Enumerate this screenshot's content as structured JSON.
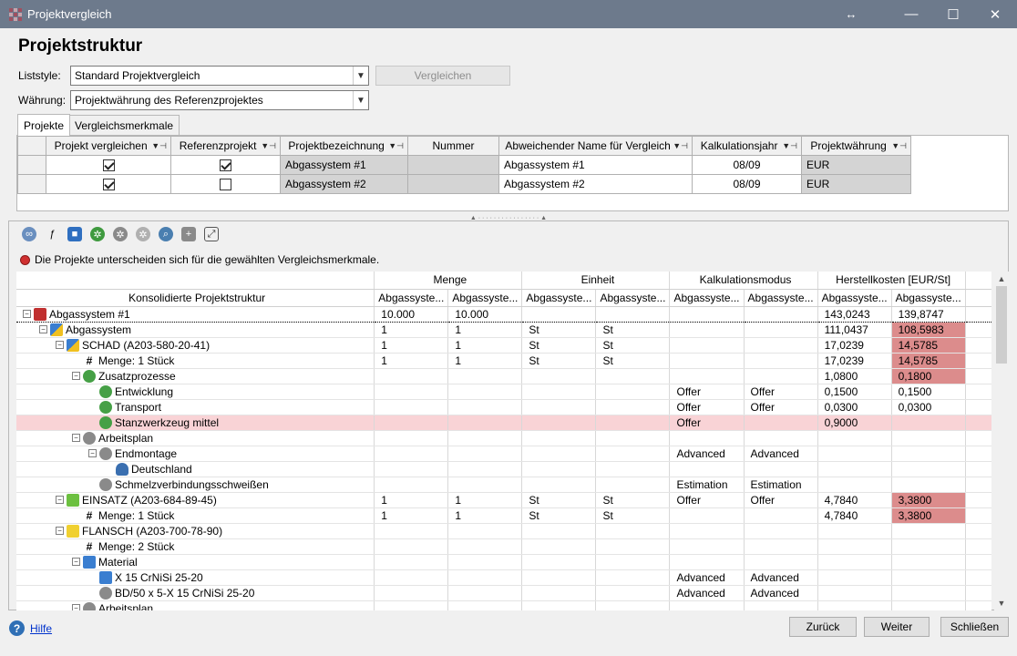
{
  "window": {
    "title": "Projektvergleich",
    "resize_glyph": "↔",
    "minimize": "—",
    "maximize": "☐",
    "close": "✕"
  },
  "page_title": "Projektstruktur",
  "liststyle": {
    "label": "Liststyle:",
    "value": "Standard Projektvergleich"
  },
  "compare_button": "Vergleichen",
  "currency": {
    "label": "Währung:",
    "value": "Projektwährung des Referenzprojektes"
  },
  "tabs": [
    {
      "label": "Projekte"
    },
    {
      "label": "Vergleichsmerkmale"
    }
  ],
  "projects_table": {
    "columns": [
      "Projekt vergleichen",
      "Referenzprojekt",
      "Projektbezeichnung",
      "Nummer",
      "Abweichender Name für Vergleich",
      "Kalkulationsjahr",
      "Projektwährung"
    ],
    "rows": [
      {
        "compare": true,
        "reference": true,
        "name": "Abgassystem #1",
        "number": "",
        "alt_name": "Abgassystem #1",
        "year": "08/09",
        "currency": "EUR"
      },
      {
        "compare": true,
        "reference": false,
        "name": "Abgassystem #2",
        "number": "",
        "alt_name": "Abgassystem #2",
        "year": "08/09",
        "currency": "EUR"
      }
    ]
  },
  "toolbar_icons": [
    "link-icon",
    "formula-icon",
    "cube-icon",
    "green-gear-icon",
    "gear-icon",
    "gear-outline-icon",
    "find-icon",
    "clipboard-add-icon",
    "expand-icon"
  ],
  "warning": "Die Projekte unterscheiden sich für die gewählten Vergleichsmerkmale.",
  "structure": {
    "tree_header": "Konsolidierte Projektstruktur",
    "groups": [
      "Menge",
      "Einheit",
      "Kalkulationsmodus",
      "Herstellkosten [EUR/St]"
    ],
    "sub_header": "Abgassyste...",
    "rows": [
      {
        "label": "Abgassystem #1",
        "indent": 0,
        "exp": "⊟",
        "icon": "project-icon",
        "c": [
          "10.000",
          "10.000",
          "",
          "",
          "",
          "",
          "143,0243",
          "139,8747"
        ],
        "hl": false
      },
      {
        "label": "Abgassystem",
        "indent": 1,
        "exp": "⊟",
        "icon": "assembly-icon",
        "c": [
          "1",
          "1",
          "St",
          "St",
          "",
          "",
          "111,0437",
          "108,5983"
        ],
        "hl": true
      },
      {
        "label": "SCHAD (A203-580-20-41)",
        "indent": 2,
        "exp": "⊟",
        "icon": "assembly-icon",
        "c": [
          "1",
          "1",
          "St",
          "St",
          "",
          "",
          "17,0239",
          "14,5785"
        ],
        "hl": true
      },
      {
        "label": "Menge: 1 Stück",
        "indent": 3,
        "exp": "",
        "icon": "hash",
        "c": [
          "1",
          "1",
          "St",
          "St",
          "",
          "",
          "17,0239",
          "14,5785"
        ],
        "hl": true
      },
      {
        "label": "Zusatzprozesse",
        "indent": 3,
        "exp": "⊟",
        "icon": "process-group-icon",
        "c": [
          "",
          "",
          "",
          "",
          "",
          "",
          "1,0800",
          "0,1800"
        ],
        "hl": true
      },
      {
        "label": "Entwicklung",
        "indent": 4,
        "exp": "",
        "icon": "process-icon",
        "c": [
          "",
          "",
          "",
          "",
          "Offer",
          "Offer",
          "0,1500",
          "0,1500"
        ],
        "hl": false
      },
      {
        "label": "Transport",
        "indent": 4,
        "exp": "",
        "icon": "process-icon",
        "c": [
          "",
          "",
          "",
          "",
          "Offer",
          "Offer",
          "0,0300",
          "0,0300"
        ],
        "hl": false
      },
      {
        "label": "Stanzwerkzeug mittel",
        "indent": 4,
        "exp": "",
        "icon": "process-icon",
        "c": [
          "",
          "",
          "",
          "",
          "Offer",
          "",
          "0,9000",
          ""
        ],
        "hl": false,
        "sel": true
      },
      {
        "label": "Arbeitsplan",
        "indent": 3,
        "exp": "⊟",
        "icon": "workplan-icon",
        "c": [
          "",
          "",
          "",
          "",
          "",
          "",
          "",
          ""
        ],
        "hl": false
      },
      {
        "label": "Endmontage",
        "indent": 4,
        "exp": "⊟",
        "icon": "operation-icon",
        "c": [
          "",
          "",
          "",
          "",
          "Advanced",
          "Advanced",
          "",
          ""
        ],
        "hl": false
      },
      {
        "label": "Deutschland",
        "indent": 5,
        "exp": "",
        "icon": "person-icon",
        "c": [
          "",
          "",
          "",
          "",
          "",
          "",
          "",
          ""
        ],
        "hl": false
      },
      {
        "label": "Schmelzverbindungsschweißen",
        "indent": 4,
        "exp": "",
        "icon": "operation-icon",
        "c": [
          "",
          "",
          "",
          "",
          "Estimation",
          "Estimation",
          "",
          ""
        ],
        "hl": false
      },
      {
        "label": "EINSATZ (A203-684-89-45)",
        "indent": 2,
        "exp": "⊟",
        "icon": "part-green-icon",
        "c": [
          "1",
          "1",
          "St",
          "St",
          "Offer",
          "Offer",
          "4,7840",
          "3,3800"
        ],
        "hl": true
      },
      {
        "label": "Menge: 1 Stück",
        "indent": 3,
        "exp": "",
        "icon": "hash",
        "c": [
          "1",
          "1",
          "St",
          "St",
          "",
          "",
          "4,7840",
          "3,3800"
        ],
        "hl": true
      },
      {
        "label": "FLANSCH (A203-700-78-90)",
        "indent": 2,
        "exp": "⊟",
        "icon": "part-yellow-icon",
        "c": [
          "",
          "",
          "",
          "",
          "",
          "",
          "",
          ""
        ],
        "hl": false
      },
      {
        "label": "Menge: 2 Stück",
        "indent": 3,
        "exp": "",
        "icon": "hash",
        "c": [
          "",
          "",
          "",
          "",
          "",
          "",
          "",
          ""
        ],
        "hl": false
      },
      {
        "label": "Material",
        "indent": 3,
        "exp": "⊟",
        "icon": "material-group-icon",
        "c": [
          "",
          "",
          "",
          "",
          "",
          "",
          "",
          ""
        ],
        "hl": false
      },
      {
        "label": "X 15 CrNiSi 25-20",
        "indent": 4,
        "exp": "",
        "icon": "material-icon",
        "c": [
          "",
          "",
          "",
          "",
          "Advanced",
          "Advanced",
          "",
          ""
        ],
        "hl": false
      },
      {
        "label": "BD/50 x 5-X 15 CrNiSi 25-20",
        "indent": 4,
        "exp": "",
        "icon": "material-bar-icon",
        "c": [
          "",
          "",
          "",
          "",
          "Advanced",
          "Advanced",
          "",
          ""
        ],
        "hl": false
      },
      {
        "label": "Arbeitsplan",
        "indent": 3,
        "exp": "⊟",
        "icon": "workplan-icon",
        "c": [
          "",
          "",
          "",
          "",
          "",
          "",
          "",
          ""
        ],
        "hl": false
      }
    ]
  },
  "footer": {
    "help": "Hilfe",
    "back": "Zurück",
    "next": "Weiter",
    "close": "Schließen"
  }
}
